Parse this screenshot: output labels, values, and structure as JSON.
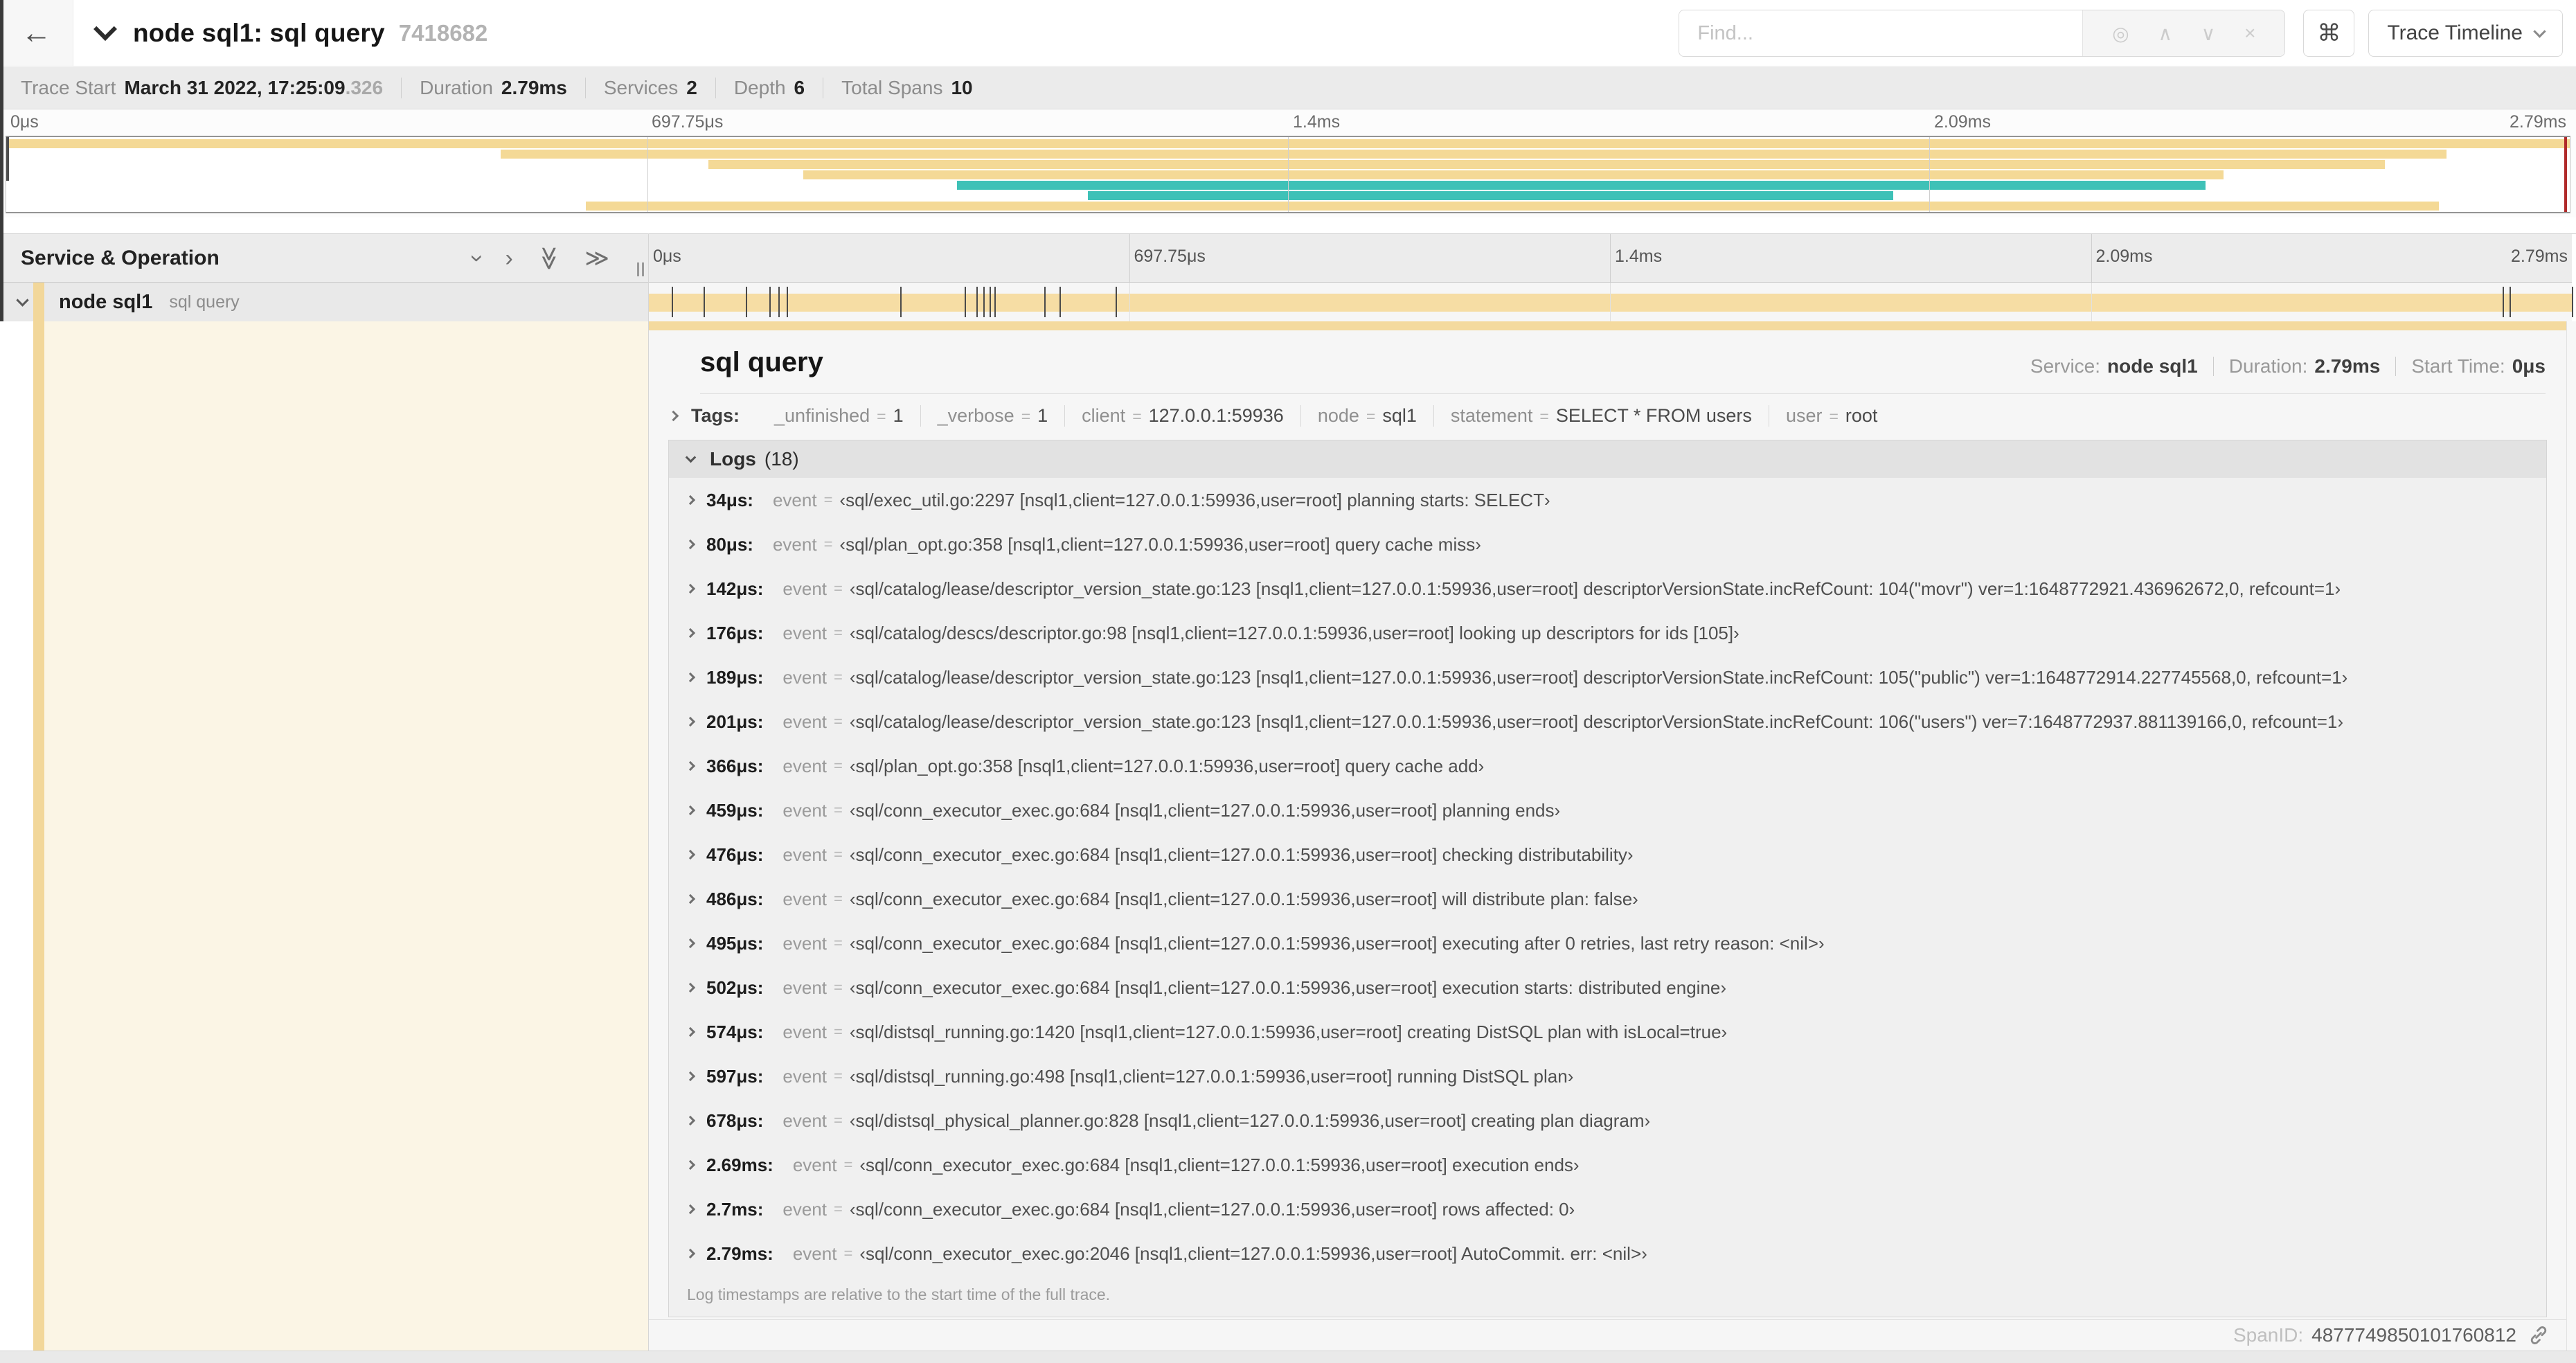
{
  "header": {
    "back_label": "←",
    "title": "node sql1: sql query",
    "trace_id": "7418682",
    "find_placeholder": "Find...",
    "search_icons": {
      "locate": "◎",
      "prev": "∧",
      "next": "∨",
      "clear": "×"
    },
    "shortcut_button": "⌘",
    "view_selector": "Trace Timeline"
  },
  "summary": {
    "items": [
      {
        "label": "Trace Start",
        "value": "March 31 2022, 17:25:09",
        "suffix": ".326"
      },
      {
        "label": "Duration",
        "value": "2.79ms"
      },
      {
        "label": "Services",
        "value": "2"
      },
      {
        "label": "Depth",
        "value": "6"
      },
      {
        "label": "Total Spans",
        "value": "10"
      }
    ]
  },
  "timeline": {
    "ticks": [
      {
        "label": "0μs",
        "pos": 0
      },
      {
        "label": "697.75μs",
        "pos": 0.25
      },
      {
        "label": "1.4ms",
        "pos": 0.5
      },
      {
        "label": "2.09ms",
        "pos": 0.75
      },
      {
        "label": "2.79ms",
        "pos": 1
      }
    ],
    "colors": {
      "span_tan": "#f4d996",
      "span_teal": "#3ec1b7",
      "view_marker": "#b02a2a"
    },
    "minimap_rows": [
      {
        "color": "tan",
        "start": 0.0,
        "end": 1.0
      },
      {
        "color": "tan",
        "start": 0.193,
        "end": 0.952
      },
      {
        "color": "tan",
        "start": 0.274,
        "end": 0.928
      },
      {
        "color": "tan",
        "start": 0.311,
        "end": 0.865
      },
      {
        "color": "teal",
        "start": 0.371,
        "end": 0.858
      },
      {
        "color": "teal",
        "start": 0.422,
        "end": 0.736
      },
      {
        "color": "tan",
        "start": 0.226,
        "end": 0.949
      }
    ]
  },
  "span_table": {
    "left_header": "Service & Operation",
    "row": {
      "service": "node sql1",
      "operation": "sql query"
    },
    "duration_total_us": 2790,
    "event_times_us": [
      34,
      80,
      142,
      176,
      189,
      201,
      366,
      459,
      476,
      486,
      495,
      502,
      574,
      597,
      678,
      2690,
      2700,
      2790
    ]
  },
  "detail": {
    "title": "sql query",
    "meta": [
      {
        "label": "Service:",
        "value": "node sql1"
      },
      {
        "label": "Duration:",
        "value": "2.79ms"
      },
      {
        "label": "Start Time:",
        "value": "0μs"
      }
    ],
    "tags_label": "Tags:",
    "tags": [
      {
        "key": "_unfinished",
        "value": "1"
      },
      {
        "key": "_verbose",
        "value": "1"
      },
      {
        "key": "client",
        "value": "127.0.0.1:59936"
      },
      {
        "key": "node",
        "value": "sql1"
      },
      {
        "key": "statement",
        "value": "SELECT * FROM users"
      },
      {
        "key": "user",
        "value": "root"
      }
    ],
    "logs_label": "Logs",
    "logs_count": "(18)",
    "log_field_key": "event",
    "logs": [
      {
        "time": "34μs:",
        "value": "‹sql/exec_util.go:2297 [nsql1,client=127.0.0.1:59936,user=root] planning starts: SELECT›"
      },
      {
        "time": "80μs:",
        "value": "‹sql/plan_opt.go:358 [nsql1,client=127.0.0.1:59936,user=root] query cache miss›"
      },
      {
        "time": "142μs:",
        "value": "‹sql/catalog/lease/descriptor_version_state.go:123 [nsql1,client=127.0.0.1:59936,user=root] descriptorVersionState.incRefCount: 104(\"movr\") ver=1:1648772921.436962672,0, refcount=1›"
      },
      {
        "time": "176μs:",
        "value": "‹sql/catalog/descs/descriptor.go:98 [nsql1,client=127.0.0.1:59936,user=root] looking up descriptors for ids [105]›"
      },
      {
        "time": "189μs:",
        "value": "‹sql/catalog/lease/descriptor_version_state.go:123 [nsql1,client=127.0.0.1:59936,user=root] descriptorVersionState.incRefCount: 105(\"public\") ver=1:1648772914.227745568,0, refcount=1›"
      },
      {
        "time": "201μs:",
        "value": "‹sql/catalog/lease/descriptor_version_state.go:123 [nsql1,client=127.0.0.1:59936,user=root] descriptorVersionState.incRefCount: 106(\"users\") ver=7:1648772937.881139166,0, refcount=1›"
      },
      {
        "time": "366μs:",
        "value": "‹sql/plan_opt.go:358 [nsql1,client=127.0.0.1:59936,user=root] query cache add›"
      },
      {
        "time": "459μs:",
        "value": "‹sql/conn_executor_exec.go:684 [nsql1,client=127.0.0.1:59936,user=root] planning ends›"
      },
      {
        "time": "476μs:",
        "value": "‹sql/conn_executor_exec.go:684 [nsql1,client=127.0.0.1:59936,user=root] checking distributability›"
      },
      {
        "time": "486μs:",
        "value": "‹sql/conn_executor_exec.go:684 [nsql1,client=127.0.0.1:59936,user=root] will distribute plan: false›"
      },
      {
        "time": "495μs:",
        "value": "‹sql/conn_executor_exec.go:684 [nsql1,client=127.0.0.1:59936,user=root] executing after 0 retries, last retry reason: <nil>›"
      },
      {
        "time": "502μs:",
        "value": "‹sql/conn_executor_exec.go:684 [nsql1,client=127.0.0.1:59936,user=root] execution starts: distributed engine›"
      },
      {
        "time": "574μs:",
        "value": "‹sql/distsql_running.go:1420 [nsql1,client=127.0.0.1:59936,user=root] creating DistSQL plan with isLocal=true›"
      },
      {
        "time": "597μs:",
        "value": "‹sql/distsql_running.go:498 [nsql1,client=127.0.0.1:59936,user=root] running DistSQL plan›"
      },
      {
        "time": "678μs:",
        "value": "‹sql/distsql_physical_planner.go:828 [nsql1,client=127.0.0.1:59936,user=root] creating plan diagram›"
      },
      {
        "time": "2.69ms:",
        "value": "‹sql/conn_executor_exec.go:684 [nsql1,client=127.0.0.1:59936,user=root] execution ends›"
      },
      {
        "time": "2.7ms:",
        "value": "‹sql/conn_executor_exec.go:684 [nsql1,client=127.0.0.1:59936,user=root] rows affected: 0›"
      },
      {
        "time": "2.79ms:",
        "value": "‹sql/conn_executor_exec.go:2046 [nsql1,client=127.0.0.1:59936,user=root] AutoCommit. err: <nil>›"
      }
    ],
    "footer_note": "Log timestamps are relative to the start time of the full trace.",
    "span_id_label": "SpanID:",
    "span_id": "4877749850101760812"
  }
}
